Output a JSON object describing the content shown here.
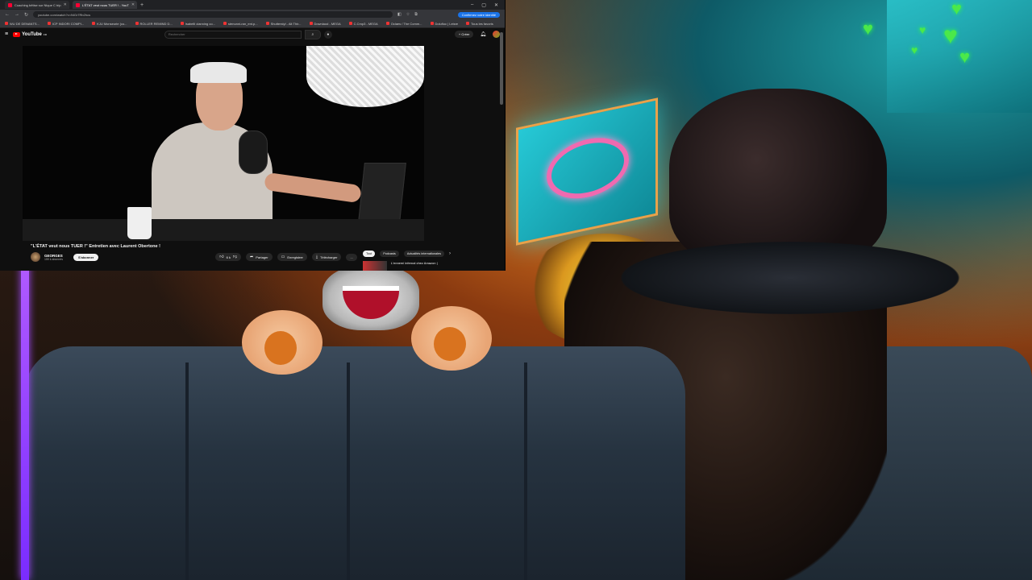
{
  "browser": {
    "tabs": [
      {
        "label": "Coaching bêtise sur Nique C trip"
      },
      {
        "label": "L'ÉTAT veut nous TUER ! - YouT"
      }
    ],
    "new_tab": "+",
    "window_controls": [
      "–",
      "▢",
      "✕"
    ],
    "url": "youtube.com/watch?v=NiGr7Rb2hcs",
    "confirm_button": "Confirmez votre identité",
    "bookmarks": [
      "WU DE DENANTS...",
      "ICP INDORI COMPI...",
      "KJU Monseurie (co...",
      "ROLLER REMIND D...",
      "Isabelli clanning co...",
      "stenunni-ran_ent.p...",
      "Shutterstyl - Alt Thir...",
      "Downlaod - MEGA",
      "C.Cmp3 - MEGA",
      "Oclaes / The Comm...",
      "Dolufioc | Leisre",
      "Tous les favoris"
    ]
  },
  "youtube": {
    "logo_text": "YouTube",
    "logo_region": "FR",
    "search_placeholder": "Rechercher",
    "create_label": "Créer",
    "video_title": "\"L'ÉTAT veut nous TUER !\" Entretien avec Laurent Obertone !",
    "channel_name": "GEORGES",
    "subscribers": "159 k abonnés",
    "subscribe_label": "S'abonner",
    "likes": "6 k",
    "share_label": "Partager",
    "save_label": "Enregistrer",
    "download_label": "Télécharger",
    "more_label": "...",
    "chips": [
      "Tout",
      "Podcasts",
      "Actualités internationales"
    ],
    "chip_next": "›",
    "recommendation_title": "L'ennemi infernal chez Amazon |"
  },
  "icons": {
    "hamburger": "menu-icon",
    "search": "search-icon",
    "mic": "mic-icon",
    "bell": "bell-icon",
    "like": "thumbs-up-icon",
    "dislike": "thumbs-down-icon"
  },
  "colors": {
    "youtube_red": "#ff0000",
    "chrome_dark": "#202124",
    "confirm_blue": "#1a73e8",
    "neon_green_hearts": "#4be84a",
    "stream_purple": "#a24bff"
  }
}
